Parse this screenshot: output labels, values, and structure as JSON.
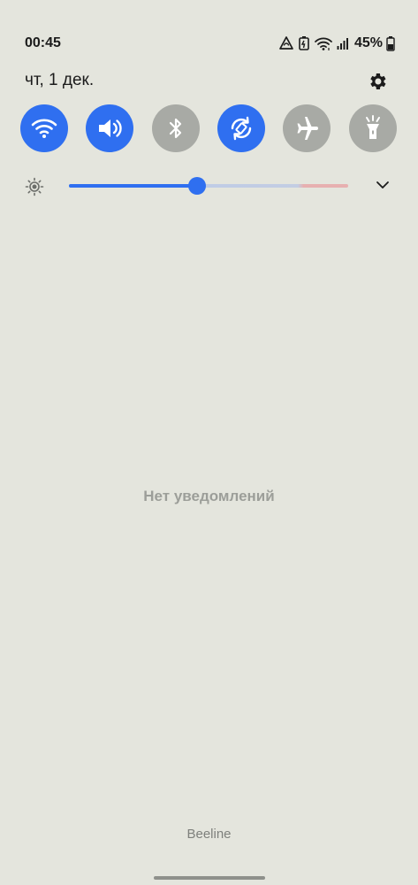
{
  "status_bar": {
    "time": "00:45",
    "battery_percent": "45%",
    "icons": [
      "data-saver-icon",
      "battery-saver-icon",
      "wifi-icon",
      "signal-icon",
      "battery-icon"
    ]
  },
  "header": {
    "date": "чт, 1 дек.",
    "settings_icon": "gear-icon"
  },
  "quick_tiles": [
    {
      "name": "wifi",
      "icon": "wifi-icon",
      "state": "on"
    },
    {
      "name": "sound",
      "icon": "volume-icon",
      "state": "on"
    },
    {
      "name": "bluetooth",
      "icon": "bluetooth-icon",
      "state": "off"
    },
    {
      "name": "auto-rotate",
      "icon": "rotate-icon",
      "state": "on"
    },
    {
      "name": "airplane-mode",
      "icon": "airplane-icon",
      "state": "off"
    },
    {
      "name": "flashlight",
      "icon": "flashlight-icon",
      "state": "off"
    }
  ],
  "brightness": {
    "level": 0.46,
    "icon": "sun-icon",
    "expand_icon": "chevron-down-icon"
  },
  "notifications": {
    "empty_text": "Нет уведомлений"
  },
  "carrier": "Beeline",
  "colors": {
    "accent": "#2f6ff0",
    "tile_off": "#a8aaa5",
    "background": "#e4e5dd"
  }
}
